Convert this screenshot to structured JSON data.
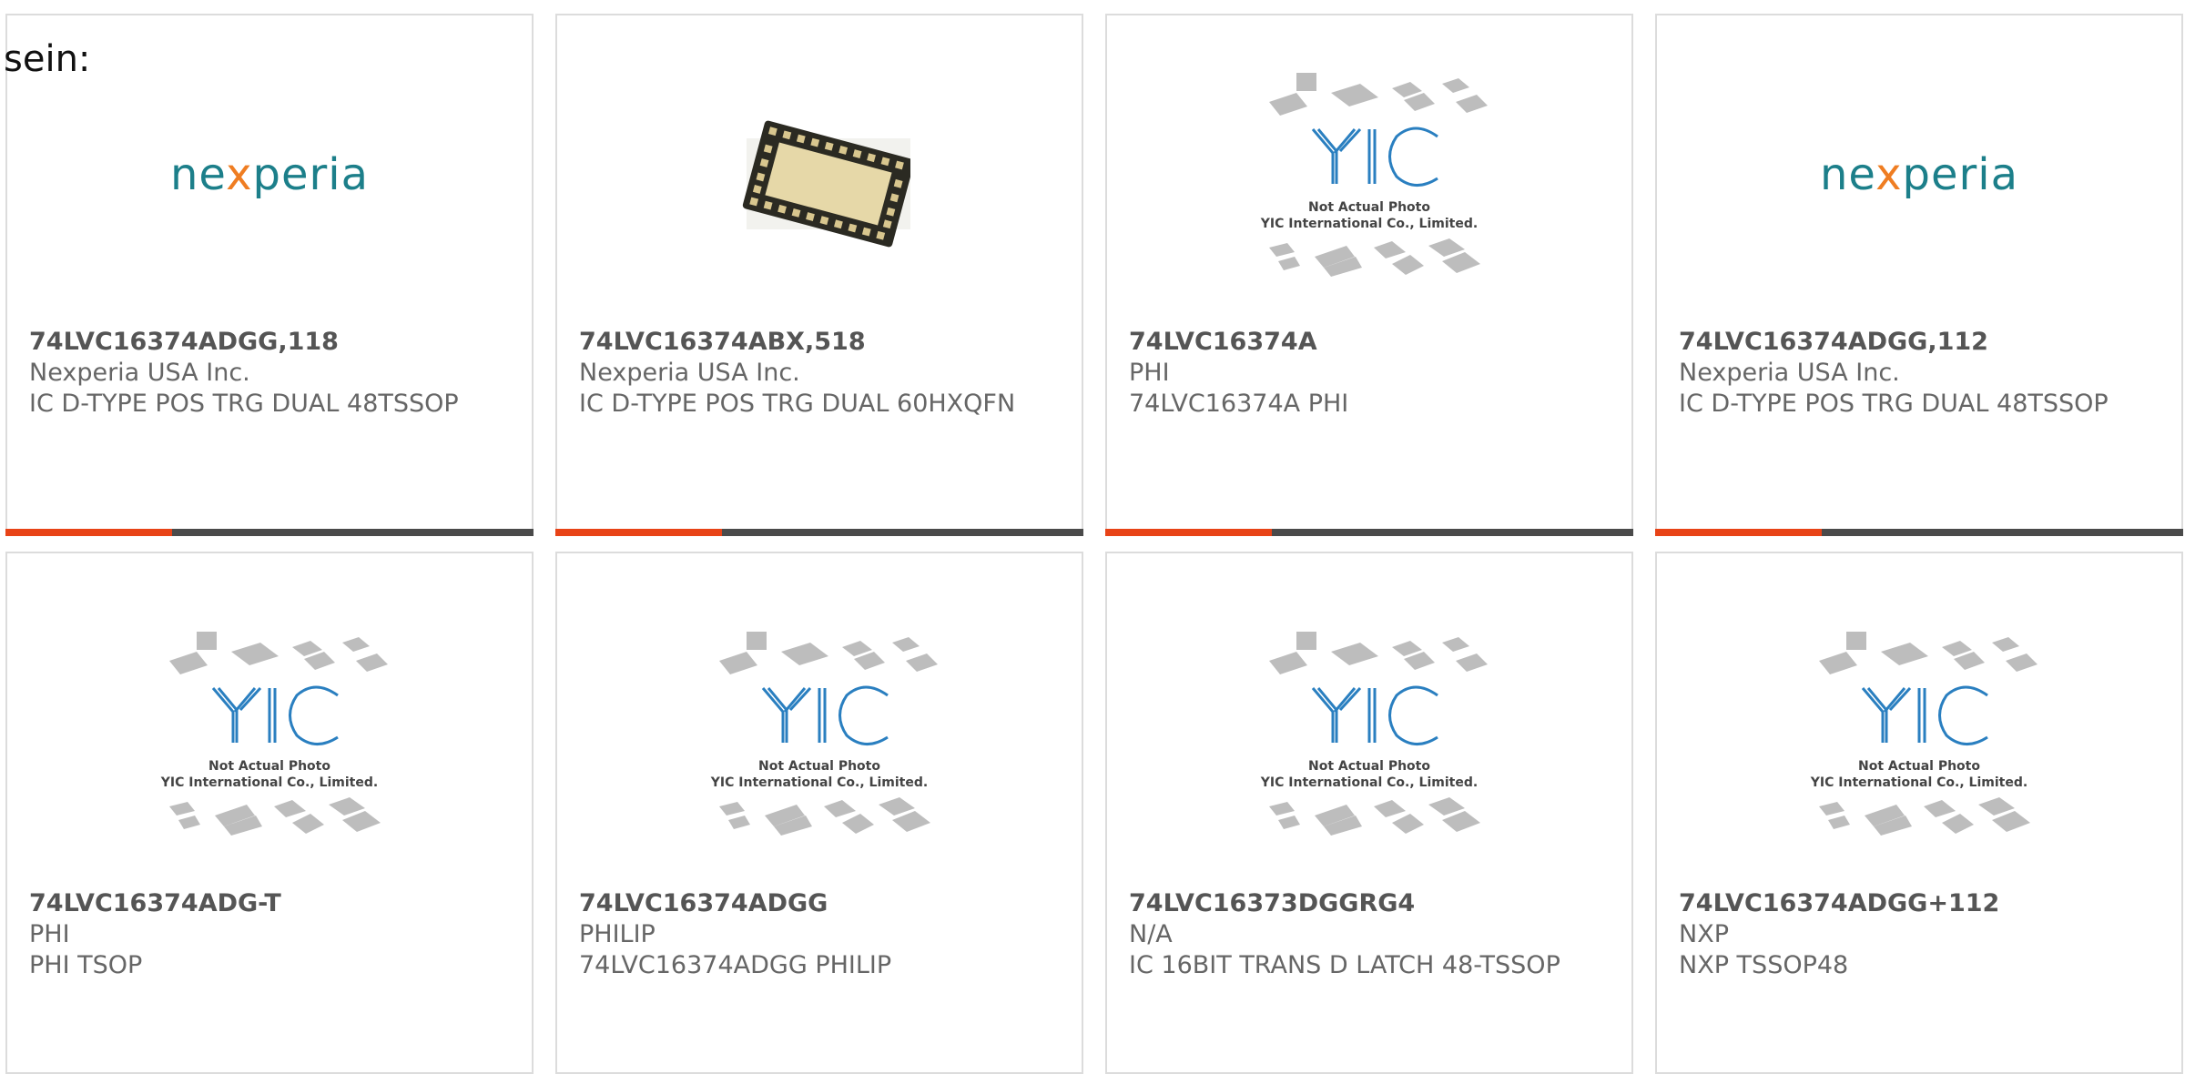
{
  "page_intro": "sein:",
  "cards": [
    {
      "part": "74LVC16374ADGG,118",
      "maker": "Nexperia USA Inc.",
      "desc": "IC D-TYPE POS TRG DUAL 48TSSOP",
      "image": "nexperia-logo"
    },
    {
      "part": "74LVC16374ABX,518",
      "maker": "Nexperia USA Inc.",
      "desc": "IC D-TYPE POS TRG DUAL 60HXQFN",
      "image": "chip-photo"
    },
    {
      "part": "74LVC16374A",
      "maker": "PHI",
      "desc": "74LVC16374A PHI",
      "image": "yic-placeholder"
    },
    {
      "part": "74LVC16374ADGG,112",
      "maker": "Nexperia USA Inc.",
      "desc": "IC D-TYPE POS TRG DUAL 48TSSOP",
      "image": "nexperia-logo"
    },
    {
      "part": "74LVC16374ADG-T",
      "maker": "PHI",
      "desc": "PHI TSOP",
      "image": "yic-placeholder"
    },
    {
      "part": "74LVC16374ADGG",
      "maker": "PHILIP",
      "desc": "74LVC16374ADGG PHILIP",
      "image": "yic-placeholder"
    },
    {
      "part": "74LVC16373DGGRG4",
      "maker": "N/A",
      "desc": "IC 16BIT TRANS D LATCH 48-TSSOP",
      "image": "yic-placeholder"
    },
    {
      "part": "74LVC16374ADGG+112",
      "maker": "NXP",
      "desc": "NXP TSSOP48",
      "image": "yic-placeholder"
    }
  ],
  "logo_text": {
    "nexperia_a": "ne",
    "nexperia_x": "x",
    "nexperia_b": "peria"
  },
  "placeholder_text": {
    "line1": "Not Actual Photo",
    "line2": "YIC International Co., Limited.",
    "brand": "YIC"
  },
  "colors": {
    "accent": "#e84317",
    "bar": "#4a4a4a",
    "border": "#dcdcdc",
    "nexperia_teal": "#1c7f8a",
    "nexperia_orange": "#ef7d22",
    "yic_blue": "#2a7fc0"
  }
}
